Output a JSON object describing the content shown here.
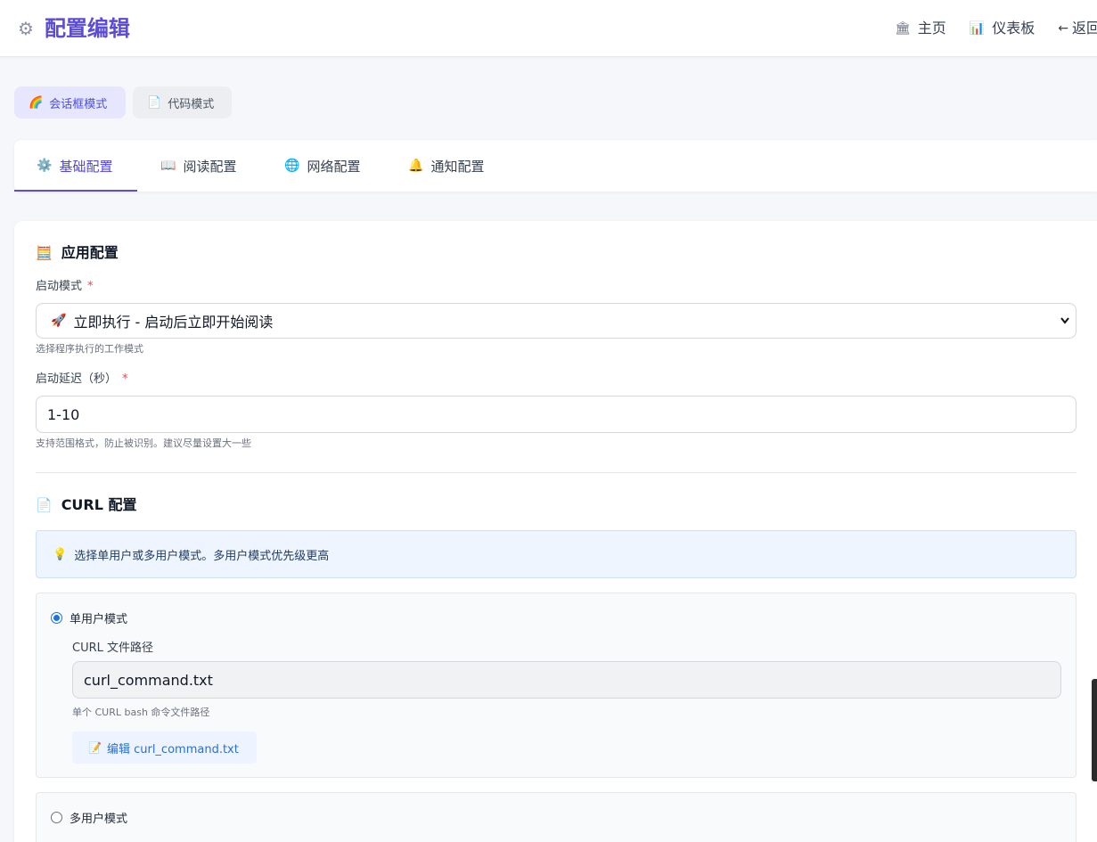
{
  "header": {
    "title": "配置编辑",
    "title_icon": "gear-icon",
    "nav": [
      {
        "icon": "🏛",
        "label": "主页"
      },
      {
        "icon": "📊",
        "label": "仪表板"
      },
      {
        "icon": "←",
        "label": "返回"
      }
    ]
  },
  "modes": {
    "dialog": {
      "icon": "🌈",
      "label": "会话框模式"
    },
    "code": {
      "icon": "📄",
      "label": "代码模式"
    }
  },
  "tabs": [
    {
      "icon": "⚙️",
      "label": "基础配置"
    },
    {
      "icon": "📖",
      "label": "阅读配置"
    },
    {
      "icon": "🌐",
      "label": "网络配置"
    },
    {
      "icon": "🔔",
      "label": "通知配置"
    }
  ],
  "app_config": {
    "title_icon": "🧮",
    "title": "应用配置",
    "start_mode_label": "启动模式",
    "required_mark": "*",
    "start_mode_icon": "🚀",
    "start_mode_value": "立即执行 - 启动后立即开始阅读",
    "start_mode_hint": "选择程序执行的工作模式",
    "delay_label": "启动延迟（秒）",
    "delay_value": "1-10",
    "delay_hint": "支持范围格式，防止被识别。建议尽量设置大一些"
  },
  "curl_config": {
    "title_icon": "📄",
    "title": "CURL 配置",
    "info_icon": "💡",
    "info": "选择单用户或多用户模式。多用户模式优先级更高",
    "single_mode_label": "单用户模式",
    "file_path_label": "CURL 文件路径",
    "file_path_value": "curl_command.txt",
    "file_path_hint": "单个 CURL bash 命令文件路径",
    "edit_icon": "📝",
    "edit_button": "编辑 curl_command.txt",
    "multi_mode_label": "多用户模式"
  }
}
